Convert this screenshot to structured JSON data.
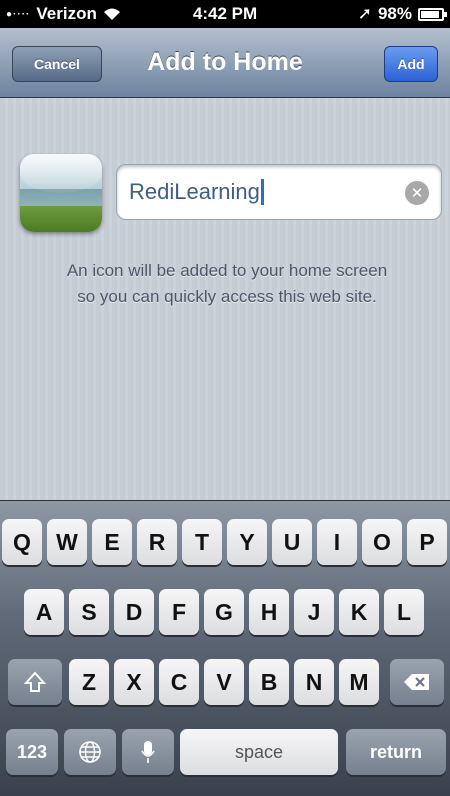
{
  "status_bar": {
    "carrier": "Verizon",
    "time": "4:42 PM",
    "battery": "98%"
  },
  "nav": {
    "title": "Add to Home",
    "cancel_label": "Cancel",
    "add_label": "Add"
  },
  "form": {
    "name_value": "RediLearning",
    "info_line1": "An icon will be added to your home screen",
    "info_line2": "so you can quickly access this web site."
  },
  "keyboard": {
    "row1": [
      "Q",
      "W",
      "E",
      "R",
      "T",
      "Y",
      "U",
      "I",
      "O",
      "P"
    ],
    "row2": [
      "A",
      "S",
      "D",
      "F",
      "G",
      "H",
      "J",
      "K",
      "L"
    ],
    "row3": [
      "Z",
      "X",
      "C",
      "V",
      "B",
      "N",
      "M"
    ],
    "numbers_label": "123",
    "space_label": "space",
    "return_label": "return"
  }
}
